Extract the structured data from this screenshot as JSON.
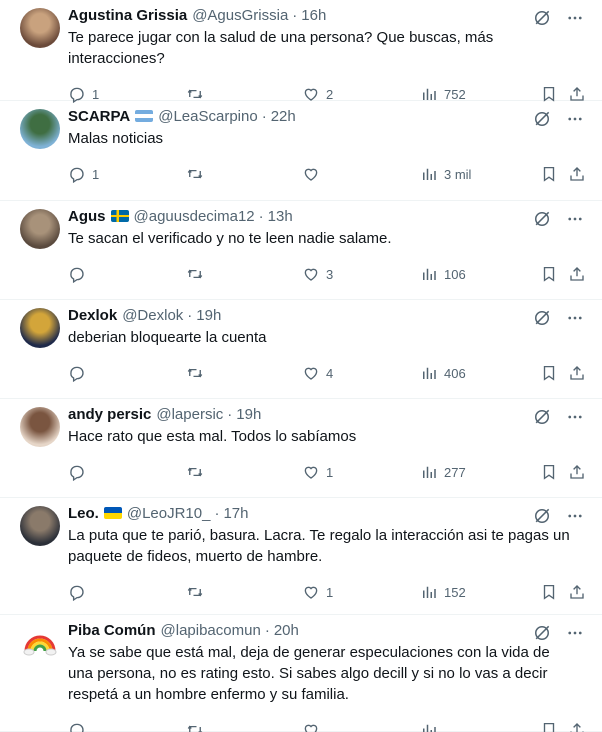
{
  "colors": {
    "text": "#0f1419",
    "muted": "#536471",
    "divider": "#eff3f4"
  },
  "icons": {
    "reply": "speech-bubble-icon",
    "retweet": "retweet-arrows-icon",
    "like": "heart-icon",
    "views": "bar-chart-icon",
    "bookmark": "bookmark-icon",
    "share": "upload-share-icon",
    "grok": "slashed-circle-icon",
    "more": "ellipsis-icon"
  },
  "tweets": [
    {
      "name": "Agustina Grissia",
      "handle": "@AgusGrissia",
      "dot": "·",
      "time": "16h",
      "text": "Te parece jugar con la salud de una persona? Que buscas, más interacciones?",
      "replies": "1",
      "retweets": "",
      "likes": "2",
      "views": "752",
      "flag": "",
      "avatar": [
        "#6b4a3a",
        "#c9a27e"
      ]
    },
    {
      "name": "SCARPA",
      "handle": "@LeaScarpino",
      "dot": "·",
      "time": "22h",
      "text": "Malas noticias",
      "replies": "1",
      "retweets": "",
      "likes": "",
      "views": "3 mil",
      "flag": "argentina",
      "avatar": [
        "#7fb2d6",
        "#3f6e42"
      ]
    },
    {
      "name": "Agus",
      "handle": "@aguusdecima12",
      "dot": "·",
      "time": "13h",
      "text": "Te sacan el verificado y no te leen nadie salame.",
      "replies": "",
      "retweets": "",
      "likes": "3",
      "views": "106",
      "flag": "sweden",
      "avatar": [
        "#5a4a3e",
        "#a8927a"
      ]
    },
    {
      "name": "Dexlok",
      "handle": "@Dexlok",
      "dot": "·",
      "time": "19h",
      "text": "deberian bloquearte la cuenta",
      "replies": "",
      "retweets": "",
      "likes": "4",
      "views": "406",
      "flag": "",
      "avatar": [
        "#1f2a4a",
        "#d3a53a"
      ]
    },
    {
      "name": "andy persic",
      "handle": "@lapersic",
      "dot": "·",
      "time": "19h",
      "text": "Hace rato que esta mal. Todos lo sabíamos",
      "replies": "",
      "retweets": "",
      "likes": "1",
      "views": "277",
      "flag": "",
      "avatar": [
        "#e6d6c8",
        "#7a5540"
      ]
    },
    {
      "name": "Leo.",
      "handle": "@LeoJR10_",
      "dot": "·",
      "time": "17h",
      "text": "La puta que te parió, basura. Lacra. Te regalo la interacción asi te pagas un paquete de fideos, muerto de hambre.",
      "replies": "",
      "retweets": "",
      "likes": "1",
      "views": "152",
      "flag": "ukraine",
      "avatar": [
        "#2b2f38",
        "#8a7a6a"
      ]
    },
    {
      "name": "Piba Común",
      "handle": "@lapibacomun",
      "dot": "·",
      "time": "20h",
      "text": "Ya se sabe que está mal, deja de generar especulaciones con la vida de una persona, no es rating esto. Si sabes algo decill y si no lo vas a decir respetá a un hombre enfermo y su familia.",
      "replies": "",
      "retweets": "",
      "likes": "",
      "views": "",
      "flag": "",
      "avatar": [
        "#ffffff",
        "#ffffff"
      ]
    }
  ]
}
